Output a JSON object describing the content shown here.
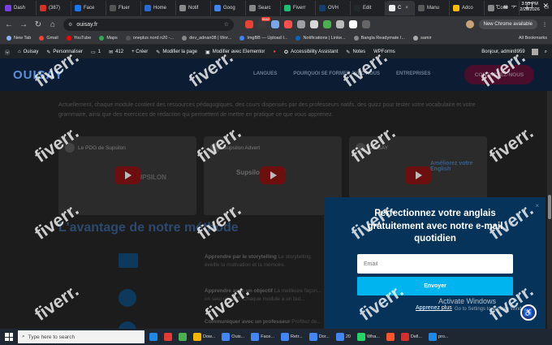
{
  "browser": {
    "tabs": [
      {
        "label": "Dash",
        "color": "#7b3fe4"
      },
      {
        "label": "(387)",
        "color": "#d93025"
      },
      {
        "label": "Face",
        "color": "#1877f2"
      },
      {
        "label": "Fluer",
        "color": "#555"
      },
      {
        "label": "Home",
        "color": "#2a6bd6"
      },
      {
        "label": "Notif",
        "color": "#8a8a8a"
      },
      {
        "label": "Goog",
        "color": "#4285f4"
      },
      {
        "label": "Searc",
        "color": "#888"
      },
      {
        "label": "Fiverr",
        "color": "#1dbf73"
      },
      {
        "label": "OVH",
        "color": "#123f6d"
      },
      {
        "label": "Edit",
        "color": "#23282d"
      },
      {
        "label": "C",
        "color": "#eee"
      },
      {
        "label": "Manu",
        "color": "#5a5a5a"
      },
      {
        "label": "Adco",
        "color": "#fbbc04"
      },
      {
        "label": "Conv",
        "color": "#888"
      }
    ],
    "active_tab_index": 11,
    "address": "ouisay.fr",
    "chrome_available": "New Chrome available",
    "ext_badge": "5542",
    "bookmarks": [
      "New Tab",
      "Gmail",
      "YouTube",
      "Maps",
      "oneplus nord n20 -...",
      "dev_adnan08 | Wor...",
      "ImgBB — Upload I...",
      "Notifications | Linke...",
      "Bangla Readymate I...",
      "samir"
    ],
    "all_bookmarks": "All Bookmarks"
  },
  "wpbar": {
    "site": "Ouisay",
    "customize": "Personnaliser",
    "comments_count": "1",
    "updates_count": "412",
    "new": "+ Créer",
    "edit_page": "Modifier la page",
    "elementor": "Modifier avec Elementor",
    "accessibility": "Accessibility Assistant",
    "notes": "Notes",
    "wpforms": "WPForms",
    "greeting": "Bonjour, admin8959"
  },
  "site": {
    "logo": "OUISAY",
    "nav": [
      "LANGUES",
      "POURQUOI SE FORMER AVEC NOUS",
      "ENTREPRISES"
    ],
    "cta": "CONTACTEZ-NOUS",
    "intro": "Actuellement, chaque module contient des ressources pédagogiques, des cours dispensés par des professeurs natifs, des quizz pour tester votre vocabulaire et votre grammaire, ainsi que des exercices de rédaction qui permettent de mettre en pratique ce que vous apprenez.",
    "videos": [
      {
        "title": "Le PDG de Supsilon",
        "overlay": "SUPSILON"
      },
      {
        "title": "Supsilon Advert",
        "overlay": "Supsilon Hiring!"
      },
      {
        "title": "OUISAY",
        "overlay": "Améliorez votre English"
      }
    ],
    "method_title": "L'avantage de notre méthode",
    "features": [
      {
        "title": "Apprendre par le storytelling",
        "text": "Le storytelling éveille la motivation et la mémoire."
      },
      {
        "title": "Apprendre avec un objectif",
        "text": "La meilleure façon... un seul objectif. Chaque module a un but..."
      },
      {
        "title": "Communiquer avec un professeur",
        "text": "Profitez de..."
      }
    ]
  },
  "popup": {
    "title": "Perfectionnez votre anglais gratuitement avec notre e-mail quotidien",
    "email_placeholder": "Email",
    "submit": "Envoyer",
    "learn_more": "Apprenez plus",
    "close": "×"
  },
  "windows_activation": {
    "title": "Activate Windows",
    "subtitle": "Go to Settings to activate Windows."
  },
  "watermark": "fiverr.",
  "taskbar": {
    "search_placeholder": "Type here to search",
    "items": [
      {
        "label": "",
        "color": "#1e88e5"
      },
      {
        "label": "",
        "color": "#e53935"
      },
      {
        "label": "",
        "color": "#4caf50"
      },
      {
        "label": "Dow...",
        "color": "#f4b400"
      },
      {
        "label": "Ouis...",
        "color": "#4285f4"
      },
      {
        "label": "Face...",
        "color": "#4285f4"
      },
      {
        "label": "Retr...",
        "color": "#4285f4"
      },
      {
        "label": "Dor...",
        "color": "#4285f4"
      },
      {
        "label": "20",
        "color": "#4285f4"
      },
      {
        "label": "Wha...",
        "color": "#25d366"
      },
      {
        "label": "",
        "color": "#fb542b"
      },
      {
        "label": "Dell...",
        "color": "#d32f2f"
      },
      {
        "label": "pro...",
        "color": "#1e88e5"
      }
    ],
    "time": "3:53 PM",
    "date": "2/20/2026"
  }
}
